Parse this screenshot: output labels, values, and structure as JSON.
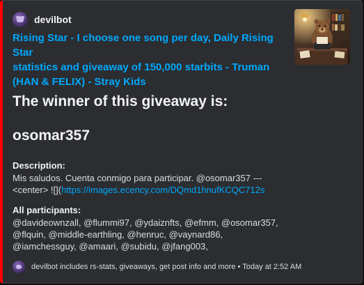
{
  "embed": {
    "accent_color": "#ff0000",
    "author": {
      "name": "devilbot",
      "avatar_icon": "devil-bot-avatar-icon"
    },
    "thumbnail": "bear-writing-at-desk-thumbnail",
    "title_line1": "Rising Star - I choose one song per day, Daily Rising Star",
    "title_line2": "statistics and giveaway of 150,000 starbits - Truman",
    "title_line3": "(HAN & FELIX) - Stray Kids",
    "winner_heading": "The winner of this giveaway is:",
    "winner_name": "osomar357",
    "description": {
      "label": "Description:",
      "line1": "Mis saludos. Cuenta conmigo para participar. @osomar357 ---",
      "line2_prefix": "<center> ![](",
      "line2_link": "https://images.ecency.com/DQmd1hnufKCQC712s"
    },
    "participants": {
      "label": "All participants:",
      "line1": "@davideownzall, @flummi97, @ydaiznfts, @efmm, @osomar357,",
      "line2": "@flquin, @middle-earthling, @henruc, @vaynard86,",
      "line3": "@iamchessguy, @amaari, @subidu, @jfang003,"
    },
    "footer": {
      "text": "devilbot includes rs-stats, giveaways, get post info and more",
      "separator": " • ",
      "timestamp": "Today at 2:52 AM"
    }
  }
}
